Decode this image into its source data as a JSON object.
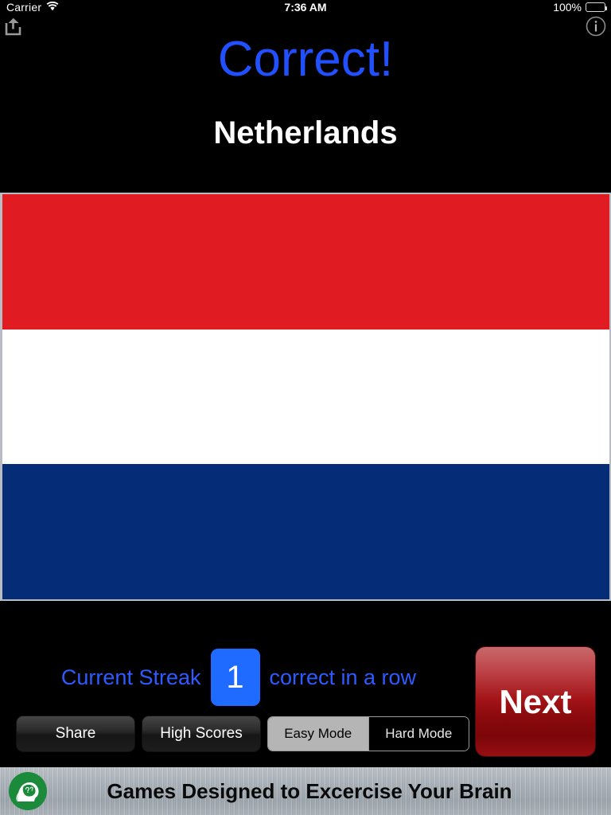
{
  "status_bar": {
    "carrier": "Carrier",
    "wifi_icon": "wifi-icon",
    "time": "7:36 AM",
    "battery_percent": "100%",
    "battery_icon": "battery-icon"
  },
  "top_bar": {
    "share_icon": "share-icon",
    "info_icon": "info-icon"
  },
  "result": {
    "verdict": "Correct!",
    "verdict_color": "#2050FF",
    "country": "Netherlands"
  },
  "flag": {
    "name": "netherlands-flag",
    "bands": [
      {
        "name": "red",
        "color": "#E01B22"
      },
      {
        "name": "white",
        "color": "#FFFFFF"
      },
      {
        "name": "blue",
        "color": "#042C77"
      }
    ],
    "border_color": "#B9BCC2"
  },
  "streak": {
    "label": "Current Streak",
    "count": "1",
    "suffix": "correct in a row",
    "text_color": "#2E5BFF",
    "box_color": "#1F6BFF"
  },
  "actions": {
    "next_label": "Next",
    "next_color": "#A31418",
    "share_label": "Share",
    "high_scores_label": "High Scores"
  },
  "mode_selector": {
    "options": [
      {
        "label": "Easy Mode",
        "selected": true
      },
      {
        "label": "Hard Mode",
        "selected": false
      }
    ]
  },
  "ad_banner": {
    "logo_icon": "brain-head-icon",
    "logo_color": "#1B8A3A",
    "text": "Games Designed to Excercise Your Brain"
  }
}
